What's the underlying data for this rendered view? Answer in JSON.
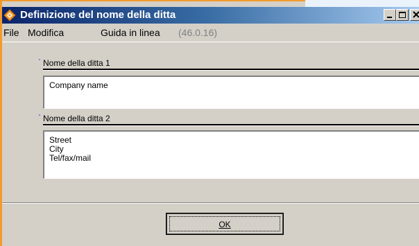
{
  "window": {
    "title": "Definizione del nome della ditta",
    "accent_color": "#f39a2b",
    "titlebar_color": "#0a246a"
  },
  "menu": {
    "items": [
      {
        "label": "File"
      },
      {
        "label": "Modifica"
      },
      {
        "label": "Guida in linea"
      }
    ],
    "version": "(46.0.16)"
  },
  "fields": [
    {
      "label": "Nome della ditta 1",
      "lines": [
        "Company name"
      ]
    },
    {
      "label": "Nome della ditta 2",
      "lines": [
        "Street",
        "City",
        "Tel/fax/mail"
      ]
    }
  ],
  "buttons": {
    "ok_label": "OK"
  },
  "icons": {
    "app": "diamond-logo-icon",
    "minimize": "minimize-icon",
    "maximize": "maximize-icon",
    "close": "close-icon"
  }
}
